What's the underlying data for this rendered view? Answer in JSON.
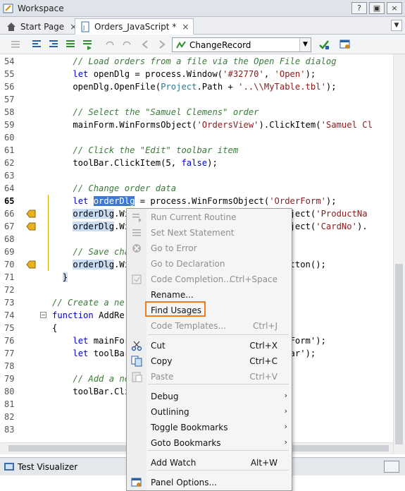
{
  "window": {
    "title": "Workspace",
    "buttons": [
      "?",
      "▣",
      "×"
    ],
    "icon": "workspace-icon"
  },
  "tabs": [
    {
      "label": "Start Page",
      "close": "×",
      "icon": "home-icon"
    },
    {
      "label": "Orders_JavaScript *",
      "close": "×",
      "icon": "script-file-icon"
    }
  ],
  "tab_dropdown": "▼",
  "toolbar": {
    "routine": "ChangeRecord",
    "combo_arrow": "▼",
    "combo_icon": "routine-icon"
  },
  "editor": {
    "lines": [
      {
        "n": "54",
        "segs": [
          [
            "    ",
            ""
          ],
          [
            "// Load orders from a file via the Open File dialog",
            "cmt"
          ]
        ]
      },
      {
        "n": "55",
        "segs": [
          [
            "    ",
            ""
          ],
          [
            "let",
            "kw"
          ],
          [
            " openDlg = process.Window(",
            ""
          ],
          [
            "'#32770'",
            "str"
          ],
          [
            ", ",
            ""
          ],
          [
            "'Open'",
            "str"
          ],
          [
            ");",
            ""
          ]
        ]
      },
      {
        "n": "56",
        "segs": [
          [
            "    openDlg.OpenFile(",
            ""
          ],
          [
            "Project",
            "prop"
          ],
          [
            ".Path + ",
            ""
          ],
          [
            "'..\\\\MyTable.tbl'",
            "str"
          ],
          [
            ");",
            ""
          ]
        ]
      },
      {
        "n": "57",
        "segs": [
          [
            "",
            ""
          ]
        ]
      },
      {
        "n": "58",
        "segs": [
          [
            "    ",
            ""
          ],
          [
            "// Select the \"Samuel Clemens\" order",
            "cmt"
          ]
        ]
      },
      {
        "n": "59",
        "segs": [
          [
            "    mainForm.WinFormsObject(",
            ""
          ],
          [
            "'OrdersView'",
            "str"
          ],
          [
            ").ClickItem(",
            ""
          ],
          [
            "'Samuel Cl",
            "str"
          ]
        ]
      },
      {
        "n": "60",
        "segs": [
          [
            "",
            ""
          ]
        ]
      },
      {
        "n": "61",
        "segs": [
          [
            "    ",
            ""
          ],
          [
            "// Click the \"Edit\" toolbar item",
            "cmt"
          ]
        ]
      },
      {
        "n": "62",
        "segs": [
          [
            "    toolBar.ClickItem(5, ",
            ""
          ],
          [
            "false",
            "kw"
          ],
          [
            ");",
            ""
          ]
        ]
      },
      {
        "n": "63",
        "segs": [
          [
            "",
            ""
          ]
        ]
      },
      {
        "n": "64",
        "segs": [
          [
            "    ",
            ""
          ],
          [
            "// Change order data",
            "cmt"
          ]
        ]
      },
      {
        "n": "65",
        "segs": [
          [
            "    ",
            ""
          ],
          [
            "let",
            "kw"
          ],
          [
            " ",
            ""
          ],
          [
            "orderDlg",
            "hl-sel"
          ],
          [
            " = process.WinFormsObject(",
            ""
          ],
          [
            "'OrderForm'",
            "str"
          ],
          [
            ");",
            ""
          ]
        ]
      },
      {
        "n": "66",
        "segs": [
          [
            "    ",
            ""
          ],
          [
            "orderDlg",
            "hl"
          ],
          [
            ".Win                           sObject(",
            ""
          ],
          [
            "'ProductNa",
            "str"
          ]
        ]
      },
      {
        "n": "67",
        "segs": [
          [
            "    ",
            ""
          ],
          [
            "orderDlg",
            "hl"
          ],
          [
            ".Win                           sObject(",
            ""
          ],
          [
            "'CardNo'",
            "str"
          ],
          [
            ").",
            ""
          ]
        ]
      },
      {
        "n": "68",
        "segs": [
          [
            "",
            ""
          ]
        ]
      },
      {
        "n": "69",
        "segs": [
          [
            "    ",
            ""
          ],
          [
            "// Save chan",
            "cmt"
          ]
        ]
      },
      {
        "n": "70",
        "segs": [
          [
            "    ",
            ""
          ],
          [
            "orderDlg",
            "hl"
          ],
          [
            ".Win                           kButton();",
            ""
          ]
        ]
      },
      {
        "n": "71",
        "segs": [
          [
            "  ",
            ""
          ],
          [
            "}",
            "hl"
          ]
        ]
      },
      {
        "n": "72",
        "segs": [
          [
            "",
            ""
          ]
        ]
      },
      {
        "n": "73",
        "segs": [
          [
            "",
            ""
          ],
          [
            "// Create a ne",
            "cmt"
          ]
        ]
      },
      {
        "n": "74",
        "segs": [
          [
            "",
            ""
          ],
          [
            "function",
            "kw"
          ],
          [
            " AddRe",
            ""
          ]
        ]
      },
      {
        "n": "75",
        "segs": [
          [
            "{",
            ""
          ]
        ]
      },
      {
        "n": "76",
        "segs": [
          [
            "    ",
            ""
          ],
          [
            "let",
            "kw"
          ],
          [
            " mainForm                           ainForm'",
            ""
          ],
          [
            ");",
            ""
          ]
        ]
      },
      {
        "n": "77",
        "segs": [
          [
            "    ",
            ""
          ],
          [
            "let",
            "kw"
          ],
          [
            " toolBar                            olBar'",
            ""
          ],
          [
            ");",
            ""
          ]
        ]
      },
      {
        "n": "78",
        "segs": [
          [
            "",
            ""
          ]
        ]
      },
      {
        "n": "79",
        "segs": [
          [
            "    ",
            ""
          ],
          [
            "// Add a new",
            "cmt"
          ]
        ]
      },
      {
        "n": "80",
        "segs": [
          [
            "    toolBar.Clic",
            ""
          ]
        ]
      },
      {
        "n": "81",
        "segs": [
          [
            "",
            ""
          ]
        ]
      },
      {
        "n": "82",
        "segs": [
          [
            "",
            ""
          ]
        ]
      },
      {
        "n": "83",
        "segs": [
          [
            "",
            ""
          ]
        ]
      }
    ]
  },
  "context_menu": {
    "items": [
      {
        "label": "Run Current Routine",
        "shortcut": "",
        "disabled": true,
        "icon": "run-routine-icon"
      },
      {
        "label": "Set Next Statement",
        "shortcut": "",
        "disabled": true,
        "icon": "next-statement-icon"
      },
      {
        "label": "Go to Error",
        "shortcut": "",
        "disabled": true,
        "icon": "error-icon"
      },
      {
        "label": "Go to Declaration",
        "shortcut": "",
        "disabled": true,
        "icon": ""
      },
      {
        "label": "Code Completion...",
        "shortcut": "Ctrl+Space",
        "disabled": true,
        "icon": "code-completion-icon"
      },
      {
        "label": "Rename...",
        "shortcut": "",
        "disabled": false,
        "icon": ""
      },
      {
        "label": "Find Usages",
        "shortcut": "",
        "disabled": false,
        "icon": ""
      },
      {
        "label": "Code Templates...",
        "shortcut": "Ctrl+J",
        "disabled": true,
        "icon": ""
      },
      {
        "label": "Cut",
        "shortcut": "Ctrl+X",
        "disabled": false,
        "icon": "scissors-icon"
      },
      {
        "label": "Copy",
        "shortcut": "Ctrl+C",
        "disabled": false,
        "icon": "copy-icon"
      },
      {
        "label": "Paste",
        "shortcut": "Ctrl+V",
        "disabled": true,
        "icon": "paste-icon"
      },
      {
        "label": "Debug",
        "shortcut": "",
        "disabled": false,
        "submenu": true,
        "icon": ""
      },
      {
        "label": "Outlining",
        "shortcut": "",
        "disabled": false,
        "submenu": true,
        "icon": ""
      },
      {
        "label": "Toggle Bookmarks",
        "shortcut": "",
        "disabled": false,
        "submenu": true,
        "icon": ""
      },
      {
        "label": "Goto Bookmarks",
        "shortcut": "",
        "disabled": false,
        "submenu": true,
        "icon": ""
      },
      {
        "label": "Add Watch",
        "shortcut": "Alt+W",
        "disabled": false,
        "icon": ""
      },
      {
        "label": "Panel Options...",
        "shortcut": "",
        "disabled": false,
        "icon": "panel-options-icon"
      }
    ],
    "submenu_arrow": "›"
  },
  "bottom_panel": {
    "label": "Test Visualizer",
    "icon": "test-visualizer-icon"
  },
  "colors": {
    "highlight": "#ef7b20",
    "selection": "#3b78d8",
    "comment": "#3b7a3b",
    "keyword": "#0000c8",
    "string": "#8b1a1a"
  }
}
